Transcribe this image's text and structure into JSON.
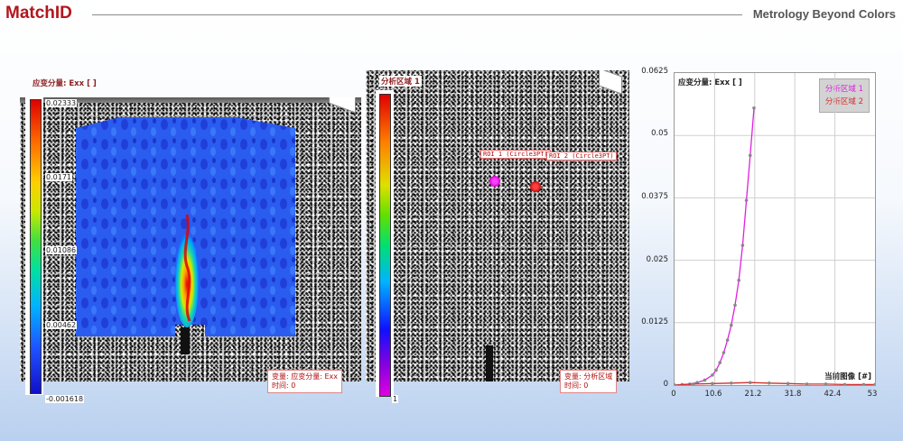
{
  "header": {
    "brand": "MatchID",
    "tagline": "Metrology Beyond Colors"
  },
  "left_panel": {
    "field_label": "应变分量: Exx [ ]",
    "colorbar_ticks": [
      "0.02333",
      "0.0171",
      "0.01086",
      "0.00462",
      "-0.001618"
    ],
    "info_line1": "变量: 应变分量: Exx",
    "info_line2": "时间: 0"
  },
  "middle_panel": {
    "field_label": "分析区域 1",
    "colorbar_ticks": [
      "1"
    ],
    "roi1_tag": "ROI 1 (Circle3PT)",
    "roi2_tag": "ROI 2 (Circle3PT)",
    "info_line1": "变量: 分析区域",
    "info_line2": "时间: 0"
  },
  "chart": {
    "ylabel_text": "应变分量: Exx [ ]",
    "xlabel_text": "当前图像 [#]",
    "y_ticks": [
      "0.0625",
      "0.05",
      "0.0375",
      "0.025",
      "0.0125",
      "0"
    ],
    "x_ticks": [
      "0",
      "10.6",
      "21.2",
      "31.8",
      "42.4",
      "53"
    ],
    "legend": [
      {
        "name": "分析区域 1",
        "color": "#e020e0"
      },
      {
        "name": "分析区域 2",
        "color": "#d03030"
      }
    ]
  },
  "chart_data": {
    "type": "line",
    "title": "",
    "ylabel": "应变分量: Exx [ ]",
    "xlabel": "当前图像 [#]",
    "xlim": [
      0,
      53
    ],
    "ylim": [
      0,
      0.0625
    ],
    "series": [
      {
        "name": "分析区域 1",
        "x": [
          0,
          2,
          4,
          6,
          8,
          10,
          11,
          12,
          13,
          14,
          15,
          16,
          17,
          18,
          19,
          20,
          21
        ],
        "y": [
          0,
          0.0001,
          0.0002,
          0.0005,
          0.001,
          0.002,
          0.003,
          0.0045,
          0.0065,
          0.009,
          0.012,
          0.016,
          0.021,
          0.028,
          0.037,
          0.046,
          0.0555
        ]
      },
      {
        "name": "分析区域 2",
        "x": [
          0,
          5,
          10,
          15,
          20,
          25,
          30,
          35,
          40,
          45,
          50,
          53
        ],
        "y": [
          0,
          0.0002,
          0.0003,
          0.0004,
          0.0005,
          0.0004,
          0.0003,
          0.0002,
          0.0002,
          0.0001,
          0.0001,
          0.0001
        ]
      }
    ]
  }
}
